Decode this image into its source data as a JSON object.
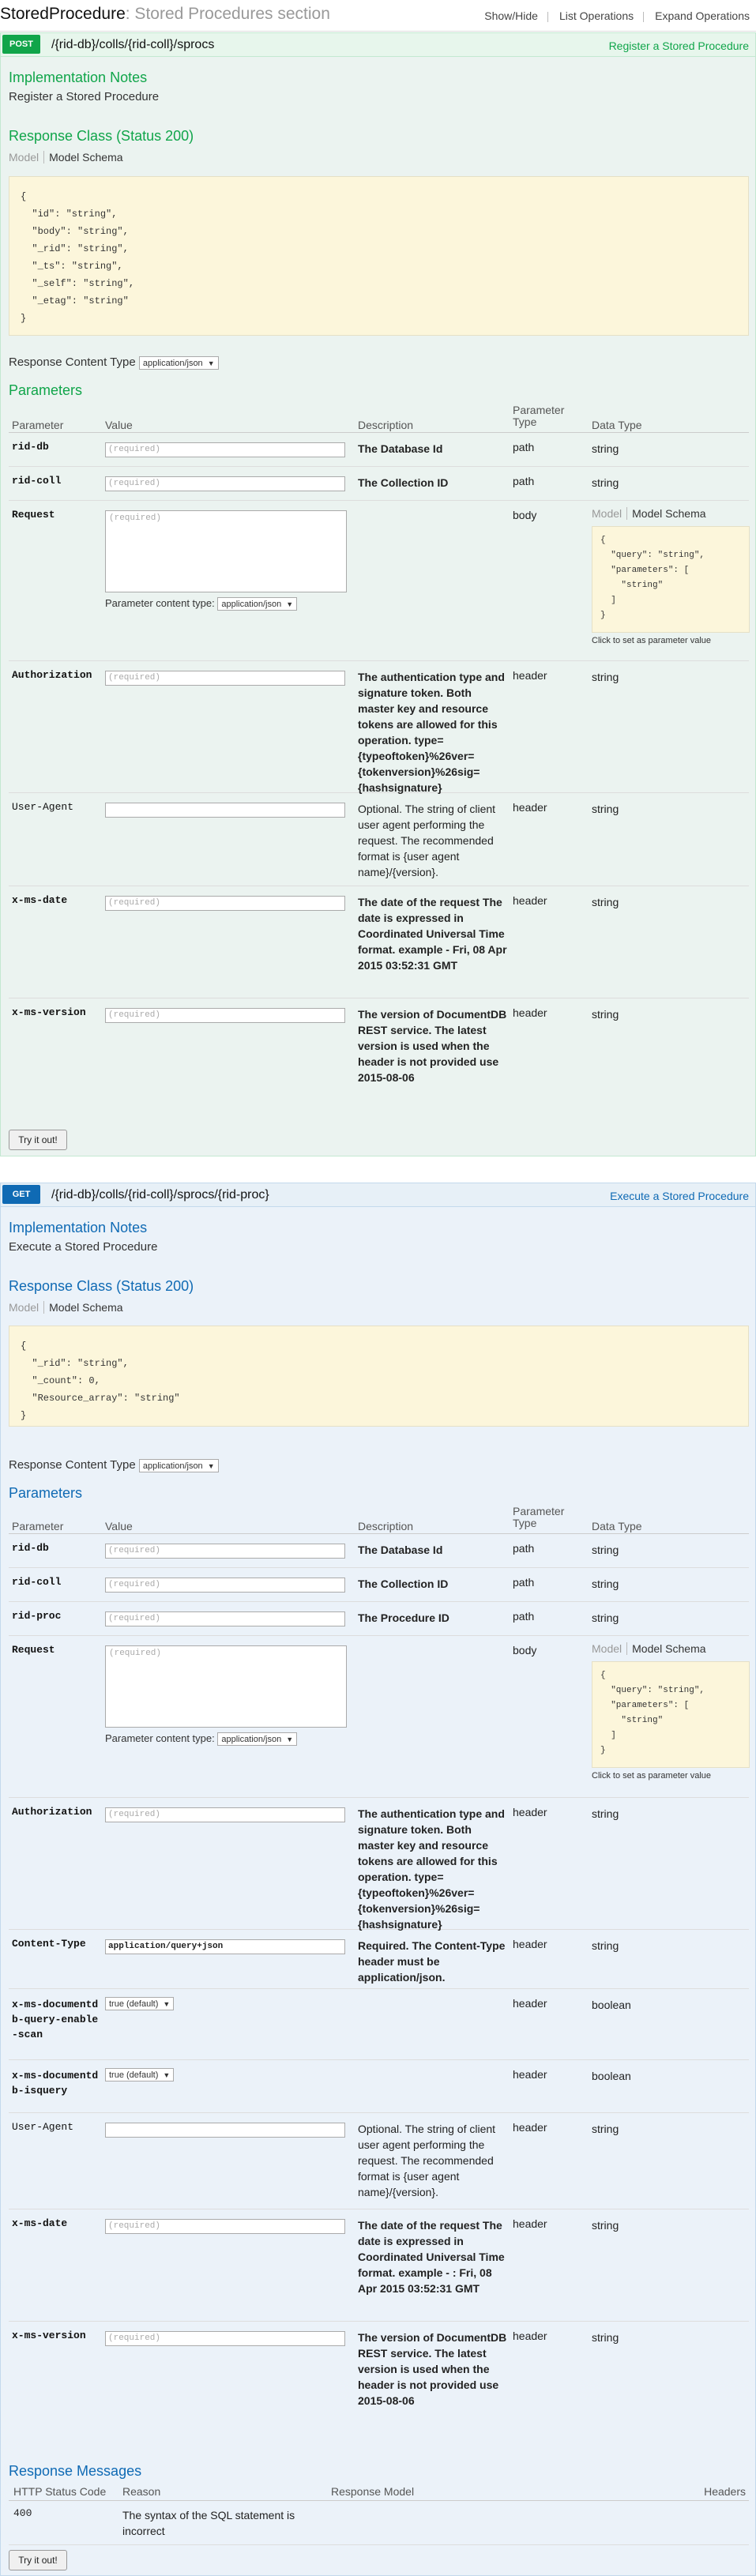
{
  "header": {
    "title": "StoredProcedure",
    "subtitle": ": Stored Procedures section",
    "links": [
      "Show/Hide",
      "List Operations",
      "Expand Operations"
    ]
  },
  "labels": {
    "implementation_notes": "Implementation Notes",
    "response_class": "Response Class (Status 200)",
    "model": "Model",
    "model_schema": "Model Schema",
    "response_content_type": "Response Content Type",
    "content_type_value": "application/json",
    "parameters": "Parameters",
    "param_headers": [
      "Parameter",
      "Value",
      "Description",
      "Parameter Type",
      "Data Type"
    ],
    "required_placeholder": "(required)",
    "parameter_content_type": "Parameter content type:",
    "click_to_set": "Click to set as parameter value",
    "try_it": "Try it out!",
    "response_messages": "Response Messages",
    "rm_headers": [
      "HTTP Status Code",
      "Reason",
      "Response Model",
      "Headers"
    ]
  },
  "post_op": {
    "method": "POST",
    "path": "/{rid-db}/colls/{rid-coll}/sprocs",
    "action": "Register a Stored Procedure",
    "note": "Register a Stored Procedure",
    "schema_lines": [
      "{",
      "  \"id\": \"string\",",
      "  \"body\": \"string\",",
      "  \"_rid\": \"string\",",
      "  \"_ts\": \"string\",",
      "  \"_self\": \"string\",",
      "  \"_etag\": \"string\"",
      "}"
    ],
    "params": [
      {
        "name": "rid-db",
        "desc": "The Database Id",
        "type": "path",
        "dtype": "string"
      },
      {
        "name": "rid-coll",
        "desc": "The Collection ID",
        "type": "path",
        "dtype": "string"
      },
      {
        "name": "Request",
        "type": "body",
        "dtype": ""
      },
      {
        "name": "Authorization",
        "desc": "The authentication type and signature token. Both master key and resource tokens are allowed for this operation. type={typeoftoken}%26ver={tokenversion}%26sig={hashsignature}",
        "type": "header",
        "dtype": "string"
      },
      {
        "name": "User-Agent",
        "desc": "Optional. The string of client user agent performing the request. The recommended format is {user agent name}/{version}.",
        "type": "header",
        "dtype": "string"
      },
      {
        "name": "x-ms-date",
        "desc": "The date of the request The date is expressed in Coordinated Universal Time format. example - Fri, 08 Apr 2015 03:52:31 GMT",
        "type": "header",
        "dtype": "string"
      },
      {
        "name": "x-ms-version",
        "desc": "The version of DocumentDB REST service. The latest version is used when the header is not provided use 2015-08-06",
        "type": "header",
        "dtype": "string"
      }
    ]
  },
  "get_op": {
    "method": "GET",
    "path": "/{rid-db}/colls/{rid-coll}/sprocs/{rid-proc}",
    "action": "Execute a Stored Procedure",
    "note": "Execute a Stored Procedure",
    "schema_lines": [
      "{",
      "  \"_rid\": \"string\",",
      "  \"_count\": 0,",
      "  \"Resource_array\": \"string\"",
      "}"
    ],
    "params": [
      {
        "name": "rid-db",
        "desc": "The Database Id",
        "type": "path",
        "dtype": "string"
      },
      {
        "name": "rid-coll",
        "desc": "The Collection ID",
        "type": "path",
        "dtype": "string"
      },
      {
        "name": "rid-proc",
        "desc": "The Procedure ID",
        "type": "path",
        "dtype": "string"
      },
      {
        "name": "Request",
        "type": "body",
        "dtype": ""
      },
      {
        "name": "Authorization",
        "desc": "The authentication type and signature token. Both master key and resource tokens are allowed for this operation. type={typeoftoken}%26ver={tokenversion}%26sig={hashsignature}",
        "type": "header",
        "dtype": "string"
      },
      {
        "name": "Content-Type",
        "value": "application/query+json",
        "desc": "Required. The Content-Type header must be application/json.",
        "type": "header",
        "dtype": "string"
      },
      {
        "name": "x-ms-documentdb-query-enable-scan",
        "value": "true (default)",
        "type": "header",
        "dtype": "boolean"
      },
      {
        "name": "x-ms-documentdb-isquery",
        "value": "true (default)",
        "type": "header",
        "dtype": "boolean"
      },
      {
        "name": "User-Agent",
        "desc": "Optional. The string of client user agent performing the request. The recommended format is {user agent name}/{version}.",
        "type": "header",
        "dtype": "string"
      },
      {
        "name": "x-ms-date",
        "desc": "The date of the request The date is expressed in Coordinated Universal Time format. example - : Fri, 08 Apr 2015 03:52:31 GMT",
        "type": "header",
        "dtype": "string"
      },
      {
        "name": "x-ms-version",
        "desc": "The version of DocumentDB REST service. The latest version is used when the header is not provided use 2015-08-06",
        "type": "header",
        "dtype": "string"
      }
    ],
    "response_messages": [
      {
        "code": "400",
        "reason": "The syntax of the SQL statement is incorrect"
      }
    ]
  },
  "request_sig": {
    "lines": [
      "{",
      "  \"query\": \"string\",",
      "  \"parameters\": [",
      "    \"string\"",
      "  ]",
      "}"
    ]
  },
  "colors": {
    "post_method": "#10a54a",
    "post_bg": "#ebf3f0",
    "get_method": "#0f6ab4",
    "get_bg": "#ebf2f9",
    "schema_bg": "#fcf6db"
  }
}
